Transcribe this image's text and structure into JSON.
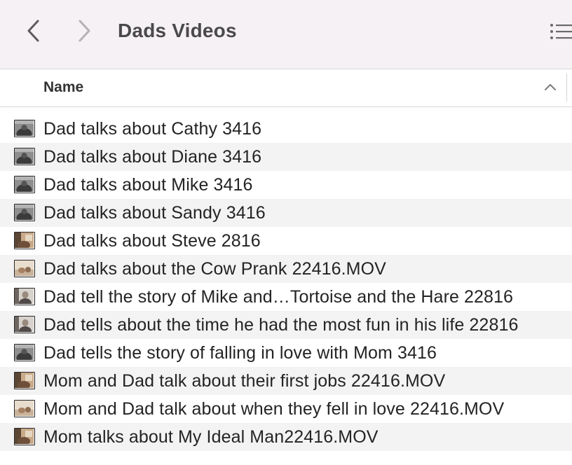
{
  "window": {
    "title": "Dads Videos",
    "back_icon": "chevron-left-icon",
    "forward_icon": "chevron-right-icon",
    "view_icon": "list-view-icon"
  },
  "colors": {
    "toolbar_bg": "#f6f1f5",
    "alt_row_bg": "#f3f3f3",
    "text": "#242424"
  },
  "header": {
    "name_label": "Name",
    "sort_icon": "chevron-up-icon"
  },
  "files": [
    {
      "name": "Dad talks about Cathy 3416",
      "thumb": "dark-gray"
    },
    {
      "name": "Dad talks about Diane 3416",
      "thumb": "dark-gray"
    },
    {
      "name": "Dad talks about Mike 3416",
      "thumb": "dark-gray"
    },
    {
      "name": "Dad talks about Sandy 3416",
      "thumb": "dark-gray"
    },
    {
      "name": "Dad talks about Steve 2816",
      "thumb": "warm-room"
    },
    {
      "name": "Dad talks about the Cow Prank 22416.MOV",
      "thumb": "light-room"
    },
    {
      "name": "Dad tell the story of Mike and…Tortoise and the Hare 22816",
      "thumb": "portrait"
    },
    {
      "name": "Dad tells about the time he had the most fun in his life 22816",
      "thumb": "portrait"
    },
    {
      "name": "Dad tells the story of falling in love with Mom 3416",
      "thumb": "dark-gray"
    },
    {
      "name": "Mom and Dad talk about their first jobs 22416.MOV",
      "thumb": "warm-room"
    },
    {
      "name": "Mom and Dad talk about when they fell in love 22416.MOV",
      "thumb": "light-room"
    },
    {
      "name": "Mom talks about My Ideal Man22416.MOV",
      "thumb": "warm-room"
    }
  ]
}
